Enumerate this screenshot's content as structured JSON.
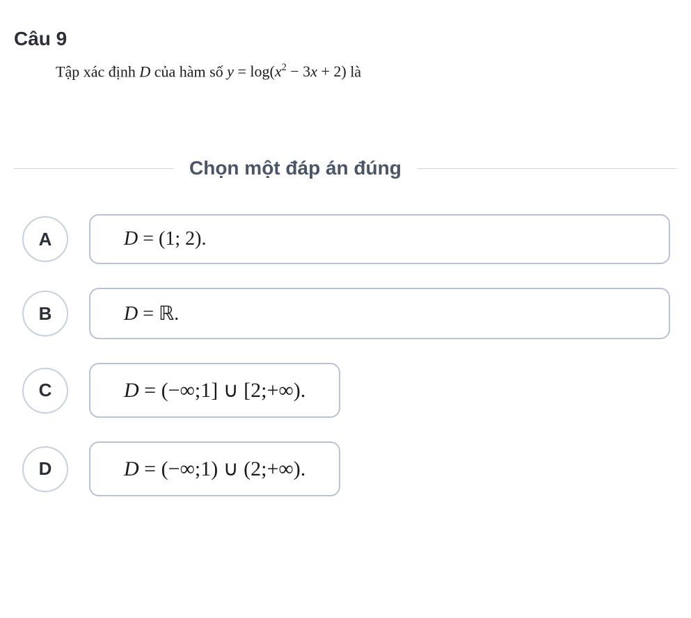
{
  "question": {
    "number_label": "Câu 9",
    "text_prefix": "Tập xác định ",
    "var_D": "D",
    "text_mid1": " của hàm số ",
    "equation": "y = log(x² − 3x + 2)",
    "text_suffix": " là"
  },
  "instruction": "Chọn một đáp án đúng",
  "options": {
    "a": {
      "letter": "A",
      "content": "D = (1; 2)."
    },
    "b": {
      "letter": "B",
      "content": "D = ℝ."
    },
    "c": {
      "letter": "C",
      "content": "D = (−∞;1] ∪ [2;+∞)."
    },
    "d": {
      "letter": "D",
      "content": "D = (−∞;1) ∪ (2;+∞)."
    }
  }
}
